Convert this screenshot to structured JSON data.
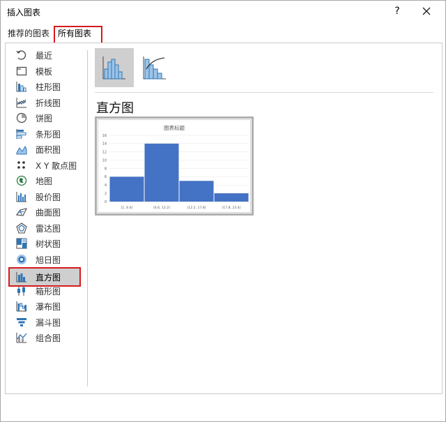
{
  "dialog": {
    "title": "插入图表",
    "help_label": "?"
  },
  "tabs": [
    {
      "label": "推荐的图表",
      "selected": false
    },
    {
      "label": "所有图表",
      "selected": true
    }
  ],
  "sidebar": {
    "items": [
      {
        "label": "最近",
        "icon": "recent-icon"
      },
      {
        "label": "模板",
        "icon": "template-icon"
      },
      {
        "label": "柱形图",
        "icon": "column-chart-icon"
      },
      {
        "label": "折线图",
        "icon": "line-chart-icon"
      },
      {
        "label": "饼图",
        "icon": "pie-chart-icon"
      },
      {
        "label": "条形图",
        "icon": "bar-chart-icon"
      },
      {
        "label": "面积图",
        "icon": "area-chart-icon"
      },
      {
        "label": "X Y 散点图",
        "icon": "scatter-chart-icon"
      },
      {
        "label": "地图",
        "icon": "map-chart-icon"
      },
      {
        "label": "股价图",
        "icon": "stock-chart-icon"
      },
      {
        "label": "曲面图",
        "icon": "surface-chart-icon"
      },
      {
        "label": "雷达图",
        "icon": "radar-chart-icon"
      },
      {
        "label": "树状图",
        "icon": "treemap-chart-icon"
      },
      {
        "label": "旭日图",
        "icon": "sunburst-chart-icon"
      },
      {
        "label": "直方图",
        "icon": "histogram-chart-icon",
        "selected": true
      },
      {
        "label": "箱形图",
        "icon": "box-whisker-chart-icon"
      },
      {
        "label": "瀑布图",
        "icon": "waterfall-chart-icon"
      },
      {
        "label": "漏斗图",
        "icon": "funnel-chart-icon"
      },
      {
        "label": "组合图",
        "icon": "combo-chart-icon"
      }
    ]
  },
  "subtypes": [
    {
      "icon": "histogram-icon",
      "selected": true
    },
    {
      "icon": "pareto-icon",
      "selected": false
    }
  ],
  "heading": "直方图",
  "colors": {
    "accent_red": "#d7191c",
    "bar_blue": "#4472c4",
    "icon_blue": "#2e75b6",
    "selected_bg": "#cfcfcf"
  },
  "chart_data": {
    "type": "bar",
    "title": "图表标题",
    "categories": [
      "[1, 6.6]",
      "(6.6, 12.2]",
      "(12.2, 17.8]",
      "(17.8, 23.4]"
    ],
    "values": [
      6,
      14,
      5,
      2
    ],
    "ylim": [
      0,
      16
    ],
    "yticks": [
      "0",
      "2",
      "4",
      "6",
      "8",
      "10",
      "12",
      "14",
      "16"
    ],
    "grid": true,
    "xlabel": "",
    "ylabel": ""
  }
}
